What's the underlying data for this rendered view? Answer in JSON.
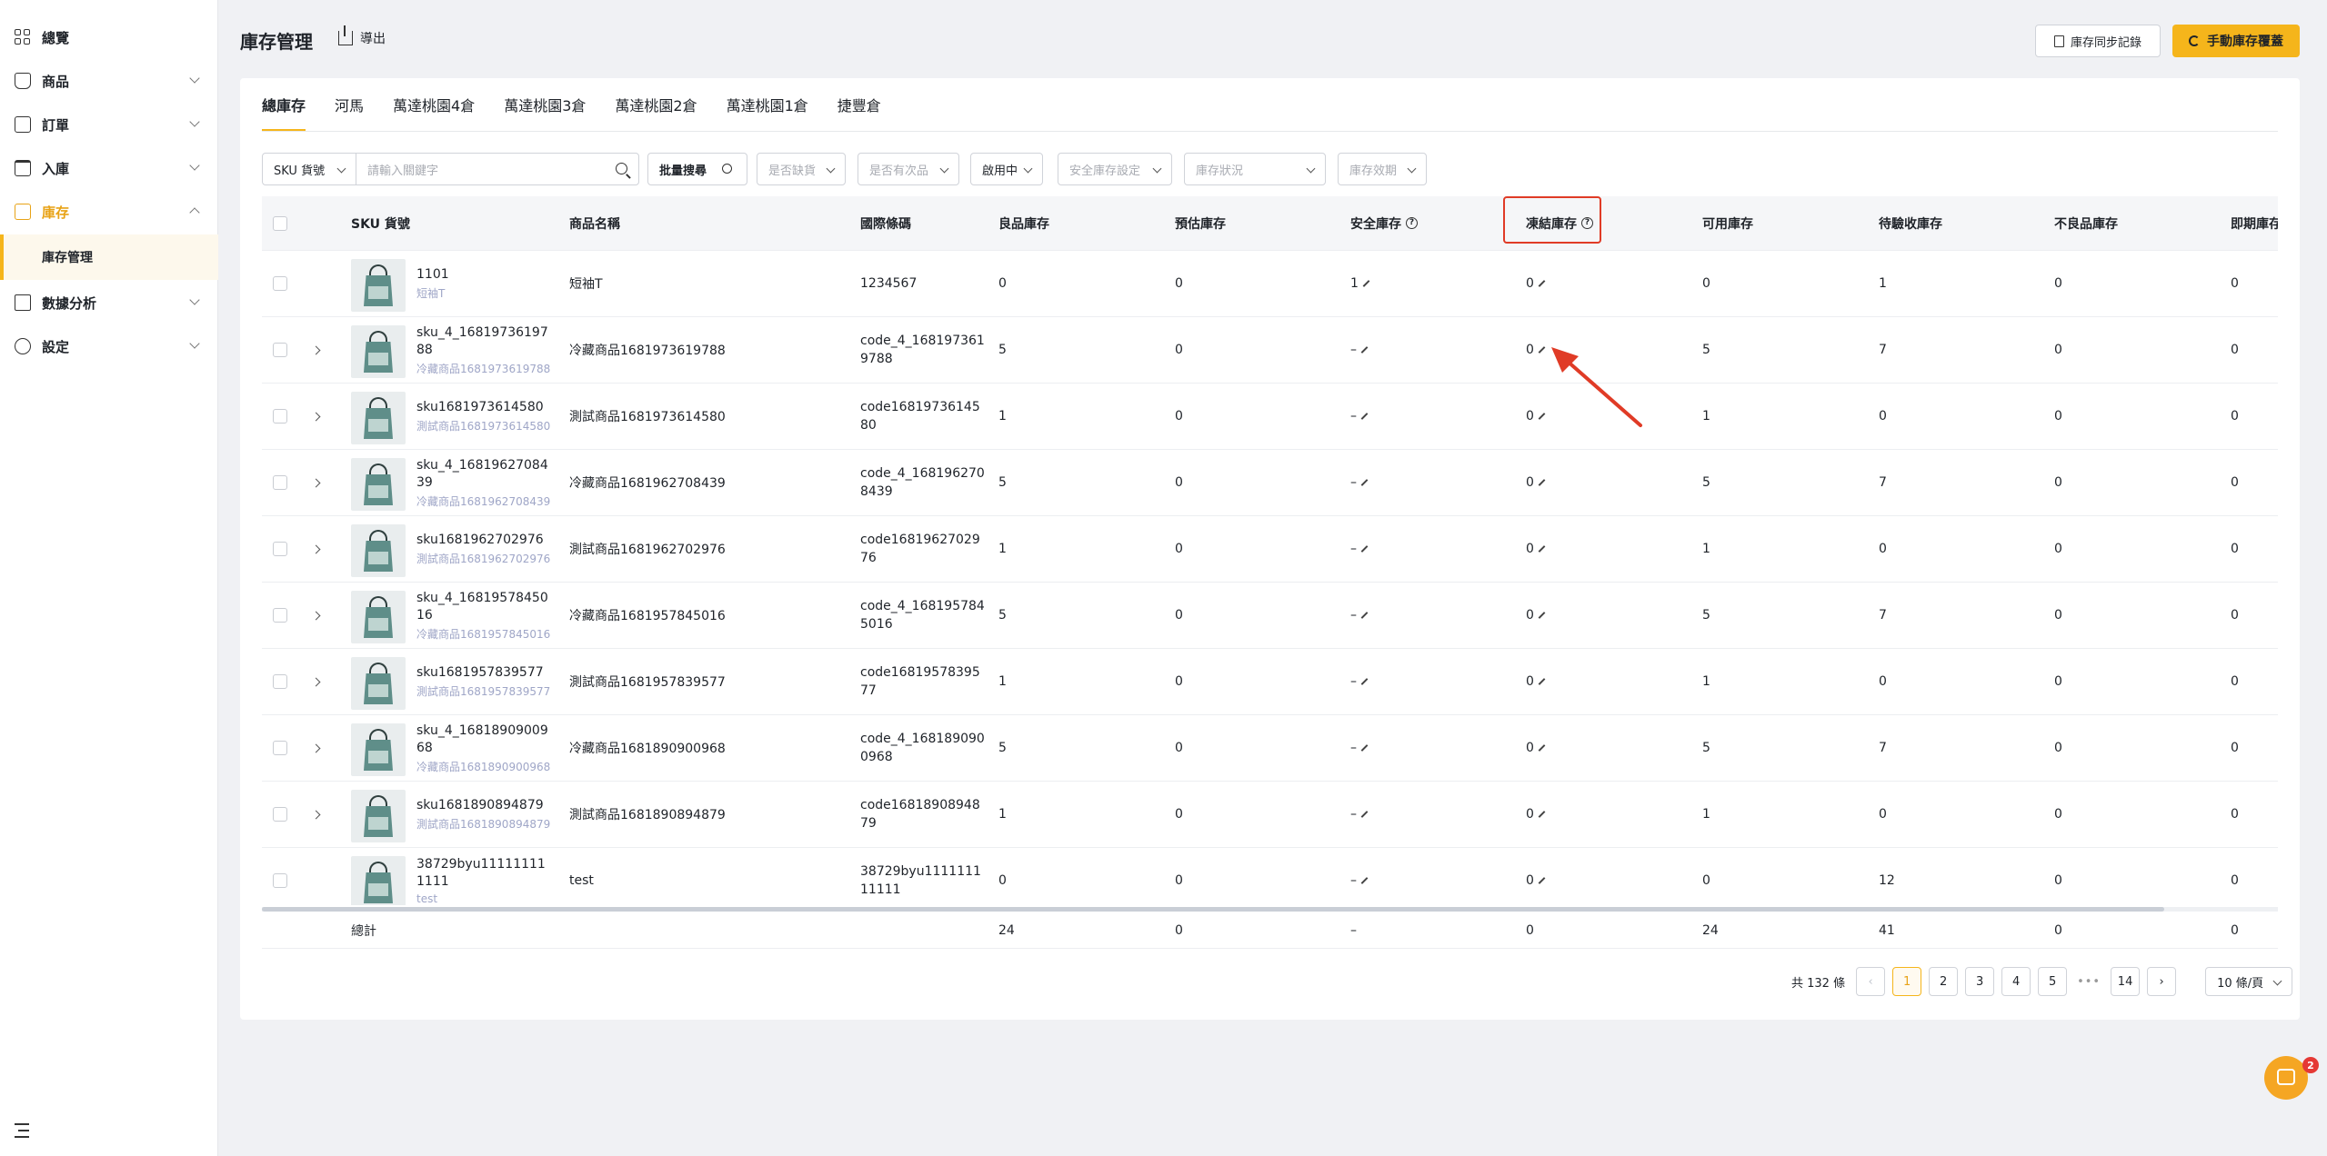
{
  "sidebar": {
    "items": [
      {
        "label": "總覽",
        "icon": "dashboard-icon"
      },
      {
        "label": "商品",
        "icon": "product-icon"
      },
      {
        "label": "訂單",
        "icon": "order-icon"
      },
      {
        "label": "入庫",
        "icon": "inbound-icon"
      },
      {
        "label": "庫存",
        "icon": "inventory-icon"
      },
      {
        "label": "數據分析",
        "icon": "analytics-icon"
      },
      {
        "label": "設定",
        "icon": "settings-icon"
      }
    ],
    "sub_item": "庫存管理"
  },
  "header": {
    "title": "庫存管理",
    "export_label": "導出",
    "sync_label": "庫存同步記錄",
    "override_label": "手動庫存覆蓋"
  },
  "tabs": [
    "總庫存",
    "河馬",
    "萬達桃園4倉",
    "萬達桃園3倉",
    "萬達桃園2倉",
    "萬達桃園1倉",
    "捷豐倉"
  ],
  "filters": {
    "sku_select": "SKU 貨號",
    "search_placeholder": "請輸入關鍵字",
    "bulk_search": "批量搜尋",
    "dropdowns": [
      "是否缺貨",
      "是否有次品",
      "啟用中",
      "安全庫存設定",
      "庫存狀況",
      "庫存效期"
    ]
  },
  "table": {
    "columns": [
      "SKU 貨號",
      "商品名稱",
      "國際條碼",
      "良品庫存",
      "預估庫存",
      "安全庫存",
      "凍結庫存",
      "可用庫存",
      "待驗收庫存",
      "不良品庫存",
      "即期庫存"
    ],
    "rows": [
      {
        "sku": "1101",
        "sub": "短袖T",
        "name": "短袖T",
        "barcode": "1234567",
        "good": "0",
        "est": "0",
        "safe": "1",
        "frozen": "0",
        "avail": "0",
        "pending": "1",
        "defect": "0",
        "expiring": "0",
        "expand": false
      },
      {
        "sku": "sku_4_1681973619788",
        "sub": "冷藏商品1681973619788",
        "name": "冷藏商品1681973619788",
        "barcode": "code_4_1681973619788",
        "good": "5",
        "est": "0",
        "safe": "–",
        "frozen": "0",
        "avail": "5",
        "pending": "7",
        "defect": "0",
        "expiring": "0",
        "expand": true
      },
      {
        "sku": "sku1681973614580",
        "sub": "測試商品1681973614580",
        "name": "測試商品1681973614580",
        "barcode": "code1681973614580",
        "good": "1",
        "est": "0",
        "safe": "–",
        "frozen": "0",
        "avail": "1",
        "pending": "0",
        "defect": "0",
        "expiring": "0",
        "expand": true
      },
      {
        "sku": "sku_4_1681962708439",
        "sub": "冷藏商品1681962708439",
        "name": "冷藏商品1681962708439",
        "barcode": "code_4_1681962708439",
        "good": "5",
        "est": "0",
        "safe": "–",
        "frozen": "0",
        "avail": "5",
        "pending": "7",
        "defect": "0",
        "expiring": "0",
        "expand": true
      },
      {
        "sku": "sku1681962702976",
        "sub": "測試商品1681962702976",
        "name": "測試商品1681962702976",
        "barcode": "code1681962702976",
        "good": "1",
        "est": "0",
        "safe": "–",
        "frozen": "0",
        "avail": "1",
        "pending": "0",
        "defect": "0",
        "expiring": "0",
        "expand": true
      },
      {
        "sku": "sku_4_1681957845016",
        "sub": "冷藏商品1681957845016",
        "name": "冷藏商品1681957845016",
        "barcode": "code_4_1681957845016",
        "good": "5",
        "est": "0",
        "safe": "–",
        "frozen": "0",
        "avail": "5",
        "pending": "7",
        "defect": "0",
        "expiring": "0",
        "expand": true
      },
      {
        "sku": "sku1681957839577",
        "sub": "測試商品1681957839577",
        "name": "測試商品1681957839577",
        "barcode": "code1681957839577",
        "good": "1",
        "est": "0",
        "safe": "–",
        "frozen": "0",
        "avail": "1",
        "pending": "0",
        "defect": "0",
        "expiring": "0",
        "expand": true
      },
      {
        "sku": "sku_4_1681890900968",
        "sub": "冷藏商品1681890900968",
        "name": "冷藏商品1681890900968",
        "barcode": "code_4_1681890900968",
        "good": "5",
        "est": "0",
        "safe": "–",
        "frozen": "0",
        "avail": "5",
        "pending": "7",
        "defect": "0",
        "expiring": "0",
        "expand": true
      },
      {
        "sku": "sku1681890894879",
        "sub": "測試商品1681890894879",
        "name": "測試商品1681890894879",
        "barcode": "code1681890894879",
        "good": "1",
        "est": "0",
        "safe": "–",
        "frozen": "0",
        "avail": "1",
        "pending": "0",
        "defect": "0",
        "expiring": "0",
        "expand": true
      },
      {
        "sku": "38729byu111111111111",
        "sub": "test",
        "name": "test",
        "barcode": "38729byu111111111111",
        "good": "0",
        "est": "0",
        "safe": "–",
        "frozen": "0",
        "avail": "0",
        "pending": "12",
        "defect": "0",
        "expiring": "0",
        "expand": false
      }
    ],
    "total": {
      "label": "總計",
      "good": "24",
      "est": "0",
      "safe": "–",
      "frozen": "0",
      "avail": "24",
      "pending": "41",
      "defect": "0",
      "expiring": "0"
    }
  },
  "pagination": {
    "total_text": "共 132 條",
    "pages": [
      "1",
      "2",
      "3",
      "4",
      "5"
    ],
    "dots": "•••",
    "last": "14",
    "prev": "‹",
    "next": "›",
    "page_size": "10 條/頁"
  },
  "chat": {
    "badge": "2"
  },
  "colors": {
    "accent": "#f5b51b",
    "highlight": "#e03b26"
  }
}
